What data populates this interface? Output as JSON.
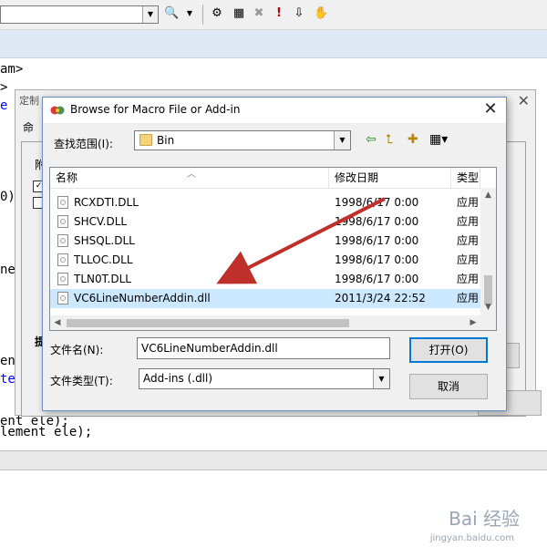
{
  "code_fragments": {
    "line1": "am>",
    "line2": ">",
    "line3": "e s",
    "line4": "0)",
    "line5": "ne",
    "line6": "en",
    "line7": "te",
    "line8": "ent ele);",
    "line9": "lement ele);"
  },
  "custom_dialog": {
    "title": "定制",
    "tab_label": "命",
    "section_label": "附",
    "hint_char": "提"
  },
  "dialog": {
    "title": "Browse for Macro File or Add-in",
    "look_in_label": "查找范围(I):",
    "look_in_value": "Bin",
    "columns": {
      "name": "名称",
      "modified": "修改日期",
      "type": "类型"
    },
    "files": [
      {
        "name": "RCXDTI.DLL",
        "modified": "1998/6/17 0:00",
        "type": "应用",
        "selected": false
      },
      {
        "name": "SHCV.DLL",
        "modified": "1998/6/17 0:00",
        "type": "应用",
        "selected": false
      },
      {
        "name": "SHSQL.DLL",
        "modified": "1998/6/17 0:00",
        "type": "应用",
        "selected": false
      },
      {
        "name": "TLLOC.DLL",
        "modified": "1998/6/17 0:00",
        "type": "应用",
        "selected": false
      },
      {
        "name": "TLN0T.DLL",
        "modified": "1998/6/17 0:00",
        "type": "应用",
        "selected": false
      },
      {
        "name": "VC6LineNumberAddin.dll",
        "modified": "2011/3/24 22:52",
        "type": "应用",
        "selected": true
      }
    ],
    "filename_label": "文件名(N):",
    "filename_value": "VC6LineNumberAddin.dll",
    "filetype_label": "文件类型(T):",
    "filetype_value": "Add-ins (.dll)",
    "open_button": "打开(O)",
    "cancel_button": "取消"
  },
  "watermark": {
    "brand": "Bai 经验",
    "url": "jingyan.baidu.com"
  },
  "colors": {
    "selection": "#cce8ff",
    "arrow": "#c0302b",
    "accent": "#0078d7"
  }
}
